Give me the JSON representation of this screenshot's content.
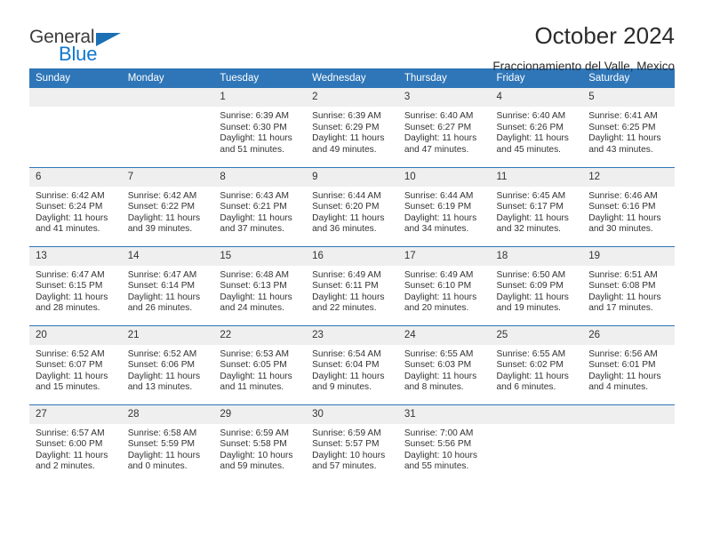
{
  "brand": {
    "name_top": "General",
    "name_bottom": "Blue",
    "accent_color": "#1177cc",
    "triangle_color": "#1a6fb5"
  },
  "header": {
    "title": "October 2024",
    "subtitle": "Fraccionamiento del Valle, Mexico"
  },
  "theme": {
    "header_bar": "#2e76b8",
    "daynum_strip": "#efefef",
    "row_divider": "#2e76b8",
    "text": "#333333"
  },
  "calendar": {
    "weekday_headers": [
      "Sunday",
      "Monday",
      "Tuesday",
      "Wednesday",
      "Thursday",
      "Friday",
      "Saturday"
    ],
    "weeks": [
      [
        {
          "day": "",
          "empty": true
        },
        {
          "day": "",
          "empty": true
        },
        {
          "day": "1",
          "sunrise": "Sunrise: 6:39 AM",
          "sunset": "Sunset: 6:30 PM",
          "daylight": "Daylight: 11 hours and 51 minutes."
        },
        {
          "day": "2",
          "sunrise": "Sunrise: 6:39 AM",
          "sunset": "Sunset: 6:29 PM",
          "daylight": "Daylight: 11 hours and 49 minutes."
        },
        {
          "day": "3",
          "sunrise": "Sunrise: 6:40 AM",
          "sunset": "Sunset: 6:27 PM",
          "daylight": "Daylight: 11 hours and 47 minutes."
        },
        {
          "day": "4",
          "sunrise": "Sunrise: 6:40 AM",
          "sunset": "Sunset: 6:26 PM",
          "daylight": "Daylight: 11 hours and 45 minutes."
        },
        {
          "day": "5",
          "sunrise": "Sunrise: 6:41 AM",
          "sunset": "Sunset: 6:25 PM",
          "daylight": "Daylight: 11 hours and 43 minutes."
        }
      ],
      [
        {
          "day": "6",
          "sunrise": "Sunrise: 6:42 AM",
          "sunset": "Sunset: 6:24 PM",
          "daylight": "Daylight: 11 hours and 41 minutes."
        },
        {
          "day": "7",
          "sunrise": "Sunrise: 6:42 AM",
          "sunset": "Sunset: 6:22 PM",
          "daylight": "Daylight: 11 hours and 39 minutes."
        },
        {
          "day": "8",
          "sunrise": "Sunrise: 6:43 AM",
          "sunset": "Sunset: 6:21 PM",
          "daylight": "Daylight: 11 hours and 37 minutes."
        },
        {
          "day": "9",
          "sunrise": "Sunrise: 6:44 AM",
          "sunset": "Sunset: 6:20 PM",
          "daylight": "Daylight: 11 hours and 36 minutes."
        },
        {
          "day": "10",
          "sunrise": "Sunrise: 6:44 AM",
          "sunset": "Sunset: 6:19 PM",
          "daylight": "Daylight: 11 hours and 34 minutes."
        },
        {
          "day": "11",
          "sunrise": "Sunrise: 6:45 AM",
          "sunset": "Sunset: 6:17 PM",
          "daylight": "Daylight: 11 hours and 32 minutes."
        },
        {
          "day": "12",
          "sunrise": "Sunrise: 6:46 AM",
          "sunset": "Sunset: 6:16 PM",
          "daylight": "Daylight: 11 hours and 30 minutes."
        }
      ],
      [
        {
          "day": "13",
          "sunrise": "Sunrise: 6:47 AM",
          "sunset": "Sunset: 6:15 PM",
          "daylight": "Daylight: 11 hours and 28 minutes."
        },
        {
          "day": "14",
          "sunrise": "Sunrise: 6:47 AM",
          "sunset": "Sunset: 6:14 PM",
          "daylight": "Daylight: 11 hours and 26 minutes."
        },
        {
          "day": "15",
          "sunrise": "Sunrise: 6:48 AM",
          "sunset": "Sunset: 6:13 PM",
          "daylight": "Daylight: 11 hours and 24 minutes."
        },
        {
          "day": "16",
          "sunrise": "Sunrise: 6:49 AM",
          "sunset": "Sunset: 6:11 PM",
          "daylight": "Daylight: 11 hours and 22 minutes."
        },
        {
          "day": "17",
          "sunrise": "Sunrise: 6:49 AM",
          "sunset": "Sunset: 6:10 PM",
          "daylight": "Daylight: 11 hours and 20 minutes."
        },
        {
          "day": "18",
          "sunrise": "Sunrise: 6:50 AM",
          "sunset": "Sunset: 6:09 PM",
          "daylight": "Daylight: 11 hours and 19 minutes."
        },
        {
          "day": "19",
          "sunrise": "Sunrise: 6:51 AM",
          "sunset": "Sunset: 6:08 PM",
          "daylight": "Daylight: 11 hours and 17 minutes."
        }
      ],
      [
        {
          "day": "20",
          "sunrise": "Sunrise: 6:52 AM",
          "sunset": "Sunset: 6:07 PM",
          "daylight": "Daylight: 11 hours and 15 minutes."
        },
        {
          "day": "21",
          "sunrise": "Sunrise: 6:52 AM",
          "sunset": "Sunset: 6:06 PM",
          "daylight": "Daylight: 11 hours and 13 minutes."
        },
        {
          "day": "22",
          "sunrise": "Sunrise: 6:53 AM",
          "sunset": "Sunset: 6:05 PM",
          "daylight": "Daylight: 11 hours and 11 minutes."
        },
        {
          "day": "23",
          "sunrise": "Sunrise: 6:54 AM",
          "sunset": "Sunset: 6:04 PM",
          "daylight": "Daylight: 11 hours and 9 minutes."
        },
        {
          "day": "24",
          "sunrise": "Sunrise: 6:55 AM",
          "sunset": "Sunset: 6:03 PM",
          "daylight": "Daylight: 11 hours and 8 minutes."
        },
        {
          "day": "25",
          "sunrise": "Sunrise: 6:55 AM",
          "sunset": "Sunset: 6:02 PM",
          "daylight": "Daylight: 11 hours and 6 minutes."
        },
        {
          "day": "26",
          "sunrise": "Sunrise: 6:56 AM",
          "sunset": "Sunset: 6:01 PM",
          "daylight": "Daylight: 11 hours and 4 minutes."
        }
      ],
      [
        {
          "day": "27",
          "sunrise": "Sunrise: 6:57 AM",
          "sunset": "Sunset: 6:00 PM",
          "daylight": "Daylight: 11 hours and 2 minutes."
        },
        {
          "day": "28",
          "sunrise": "Sunrise: 6:58 AM",
          "sunset": "Sunset: 5:59 PM",
          "daylight": "Daylight: 11 hours and 0 minutes."
        },
        {
          "day": "29",
          "sunrise": "Sunrise: 6:59 AM",
          "sunset": "Sunset: 5:58 PM",
          "daylight": "Daylight: 10 hours and 59 minutes."
        },
        {
          "day": "30",
          "sunrise": "Sunrise: 6:59 AM",
          "sunset": "Sunset: 5:57 PM",
          "daylight": "Daylight: 10 hours and 57 minutes."
        },
        {
          "day": "31",
          "sunrise": "Sunrise: 7:00 AM",
          "sunset": "Sunset: 5:56 PM",
          "daylight": "Daylight: 10 hours and 55 minutes."
        },
        {
          "day": "",
          "empty": true
        },
        {
          "day": "",
          "empty": true
        }
      ]
    ]
  }
}
